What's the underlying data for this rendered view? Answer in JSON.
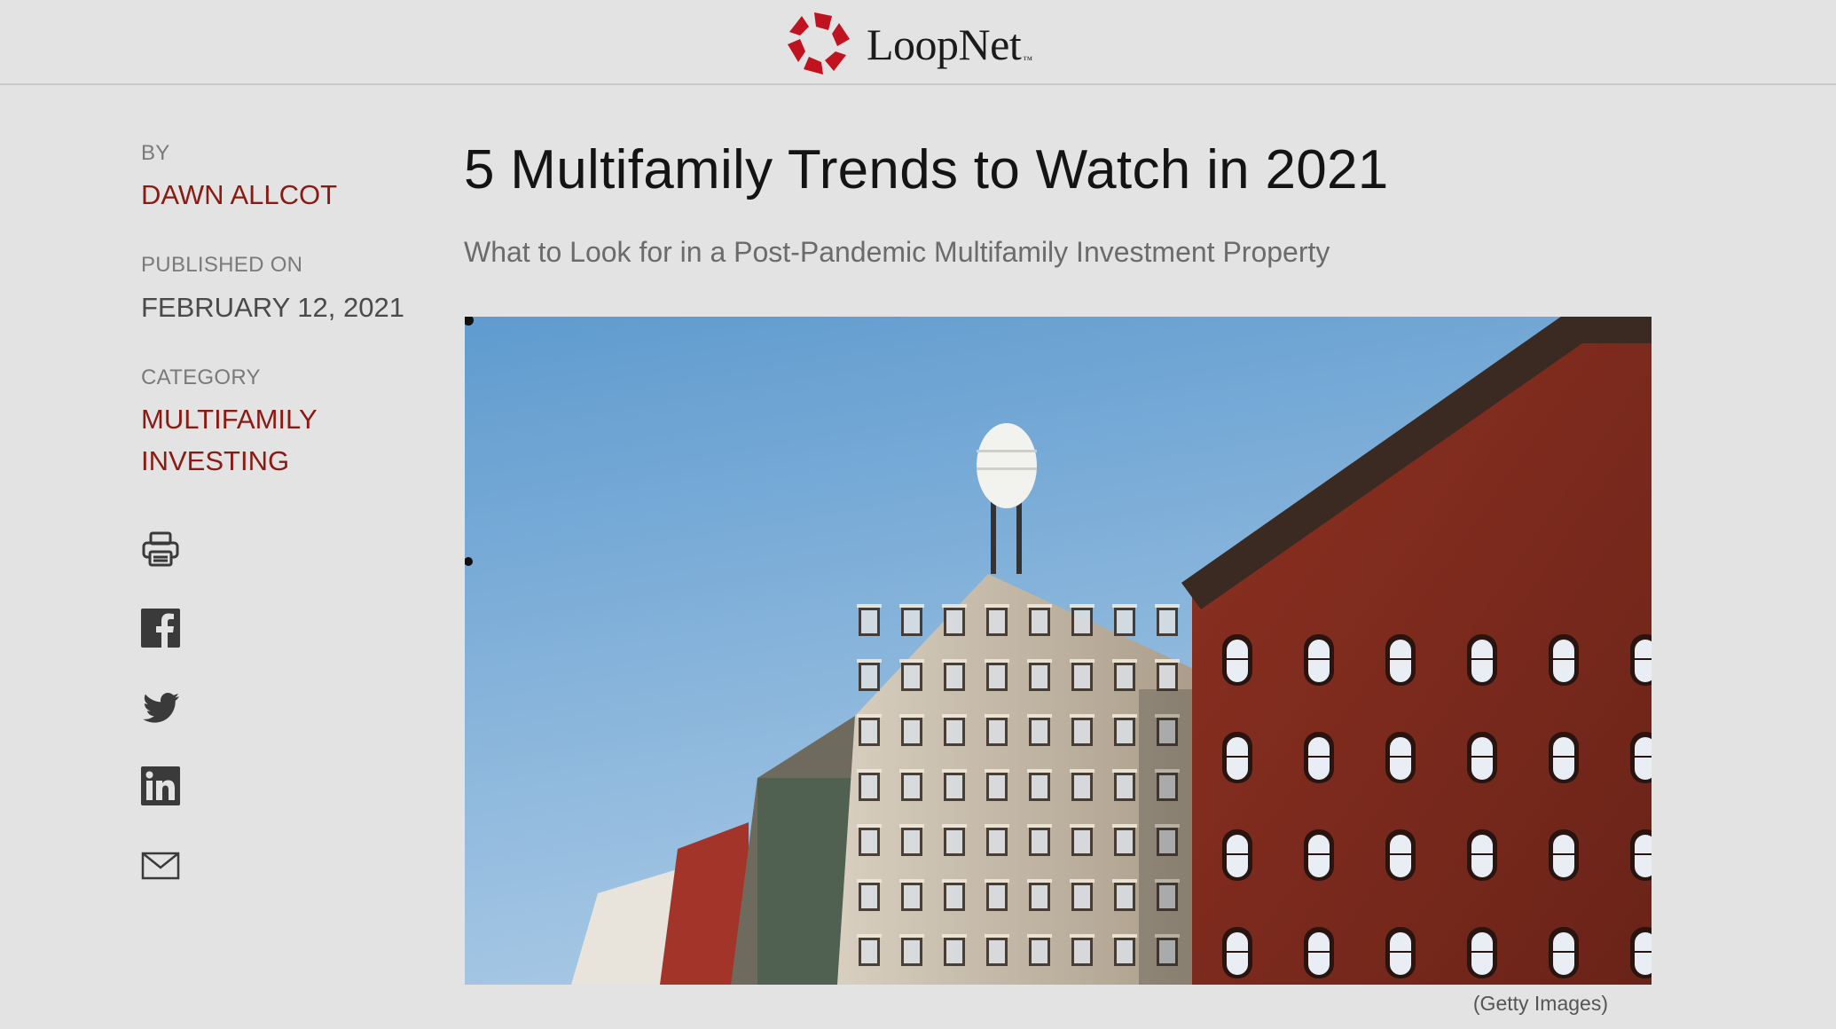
{
  "header": {
    "brand_name": "LoopNet",
    "brand_tm": "™",
    "brand_color": "#c1121f"
  },
  "sidebar": {
    "by_label": "BY",
    "author": "DAWN ALLCOT",
    "published_label": "PUBLISHED ON",
    "published_date": "FEBRUARY 12, 2021",
    "category_label": "CATEGORY",
    "category_line1": "MULTIFAMILY",
    "category_line2": "INVESTING",
    "share_icons": [
      "printer-icon",
      "facebook-icon",
      "twitter-icon",
      "linkedin-icon",
      "email-icon"
    ]
  },
  "article": {
    "title": "5 Multifamily Trends to Watch in 2021",
    "subtitle": "What to Look for in a Post-Pandemic Multifamily Investment Property",
    "image_caption": "(Getty Images)"
  },
  "colors": {
    "accent_red": "#8b1a12",
    "background": "#e3e3e3",
    "sky": "#7eaed6"
  }
}
